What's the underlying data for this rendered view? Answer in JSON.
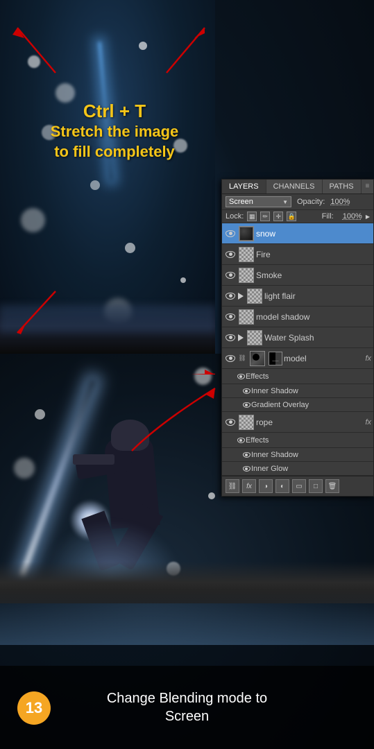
{
  "tutorial": {
    "step_number": "13",
    "top_instruction_line1": "Ctrl + T",
    "top_instruction_line2": "Stretch the image\nto fill completely",
    "bottom_instruction": "Change Blending mode to\nScreen"
  },
  "ps_panel": {
    "tabs": [
      "LAYERS",
      "CHANNELS",
      "PATHS"
    ],
    "active_tab": "LAYERS",
    "blend_mode": "Screen",
    "opacity_label": "Opacity:",
    "opacity_value": "100%",
    "lock_label": "Lock:",
    "fill_label": "Fill:",
    "fill_value": "100%",
    "layers": [
      {
        "name": "snow",
        "visible": true,
        "selected": true,
        "type": "normal",
        "has_fx": false
      },
      {
        "name": "Fire",
        "visible": true,
        "selected": false,
        "type": "fire",
        "has_fx": false
      },
      {
        "name": "Smoke",
        "visible": true,
        "selected": false,
        "type": "transparent",
        "has_fx": false
      },
      {
        "name": "light flair",
        "visible": true,
        "selected": false,
        "type": "transparent",
        "has_arrow": true,
        "has_fx": false
      },
      {
        "name": "model shadow",
        "visible": true,
        "selected": false,
        "type": "transparent",
        "has_fx": false
      },
      {
        "name": "Water Splash",
        "visible": true,
        "selected": false,
        "type": "transparent",
        "has_arrow": true,
        "has_fx": false
      },
      {
        "name": "model",
        "visible": true,
        "selected": false,
        "type": "model",
        "has_fx": true,
        "has_chain": true
      },
      {
        "name": "Effects",
        "visible": false,
        "selected": false,
        "is_effects": true
      },
      {
        "name": "Inner Shadow",
        "visible": false,
        "selected": false,
        "is_effect_item": true
      },
      {
        "name": "Gradient Overlay",
        "visible": false,
        "selected": false,
        "is_effect_item": true
      },
      {
        "name": "rope",
        "visible": true,
        "selected": false,
        "type": "transparent",
        "has_fx": true
      },
      {
        "name": "Effects",
        "visible": false,
        "selected": false,
        "is_effects": true,
        "second": true
      },
      {
        "name": "Inner Shadow",
        "visible": false,
        "selected": false,
        "is_effect_item": true,
        "second": true
      },
      {
        "name": "Inner Glow",
        "visible": false,
        "selected": false,
        "is_effect_item": true,
        "second": true
      }
    ],
    "toolbar_buttons": [
      "link",
      "fx",
      "mask",
      "adjust",
      "group",
      "new",
      "delete"
    ]
  }
}
